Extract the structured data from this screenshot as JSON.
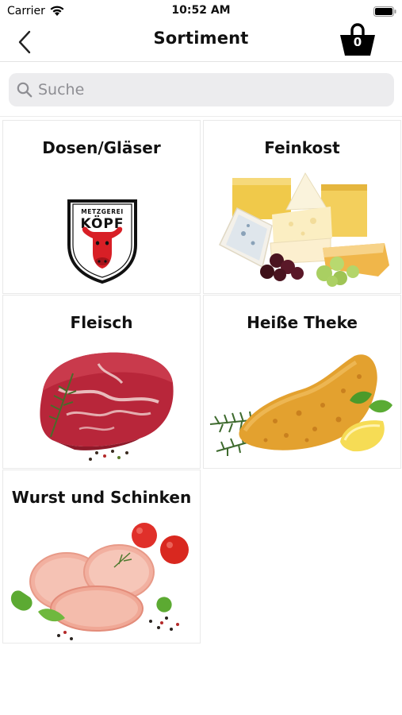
{
  "status": {
    "carrier": "Carrier",
    "time": "10:52 AM"
  },
  "nav": {
    "title": "Sortiment",
    "cart_count": "0"
  },
  "search": {
    "placeholder": "Suche",
    "value": ""
  },
  "categories": [
    {
      "title": "Dosen/Gläser",
      "image": "metzgerei-logo"
    },
    {
      "title": "Feinkost",
      "image": "cheese-platter"
    },
    {
      "title": "Fleisch",
      "image": "raw-beef"
    },
    {
      "title": "Heiße Theke",
      "image": "schnitzel"
    },
    {
      "title": "Wurst und Schinken",
      "image": "sliced-sausage"
    }
  ],
  "logo": {
    "top_text": "METZGEREI",
    "brand": "KÖPF"
  },
  "colors": {
    "accent": "#d81f26",
    "text": "#111111",
    "search_bg": "#ececee"
  }
}
